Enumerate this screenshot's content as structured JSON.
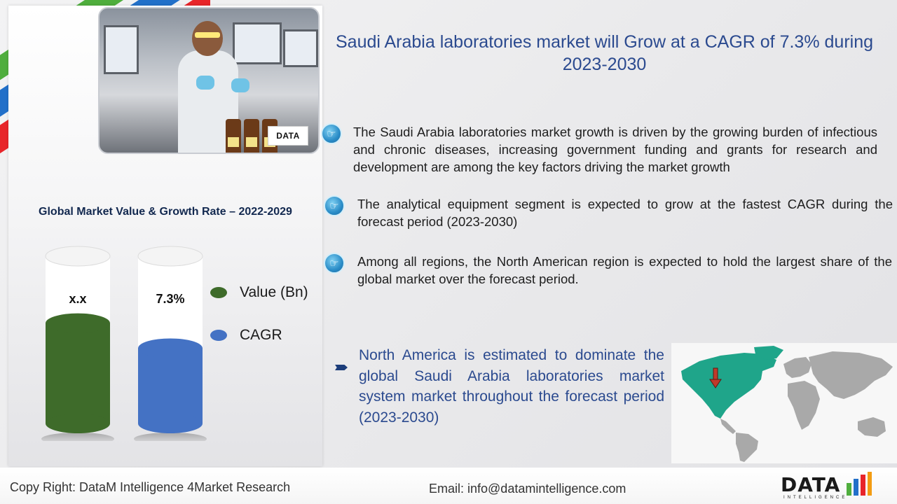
{
  "title": "Saudi Arabia laboratories market will Grow at a CAGR of 7.3% during 2023-2030",
  "photo": {
    "logo_text": "DATA"
  },
  "chart": {
    "title": "Global Market Value & Growth Rate – 2022-2029",
    "legend": [
      {
        "label": "Value (Bn)",
        "color": "#3e6b2a"
      },
      {
        "label": "CAGR",
        "color": "#4472c4"
      }
    ]
  },
  "chart_data": {
    "type": "bar",
    "title": "Global Market Value & Growth Rate – 2022-2029",
    "categories": [
      "Value (Bn)",
      "CAGR"
    ],
    "series": [
      {
        "name": "Value (Bn)",
        "label": "x.x",
        "fill_fraction": 0.6,
        "color": "#3e6b2a"
      },
      {
        "name": "CAGR",
        "label": "7.3%",
        "fill_fraction": 0.45,
        "color": "#4472c4"
      }
    ]
  },
  "bullets": [
    {
      "text": "The Saudi Arabia laboratories market growth is driven by the growing burden of infectious and chronic diseases, increasing government funding and grants for research and development are among the key factors driving the market growth"
    },
    {
      "text": "The analytical equipment segment is expected to grow at the fastest CAGR during the forecast period (2023-2030)"
    },
    {
      "text": "Among all regions, the North American region is expected to hold the largest share of the global market over the forecast period."
    }
  ],
  "highlight": "North America is estimated to dominate the global Saudi Arabia laboratories market system market throughout the forecast period (2023-2030)",
  "colors": {
    "accent": "#2b4a8f",
    "map_highlight": "#1fa58a",
    "map_base": "#a9a9a9"
  },
  "footer": {
    "copyright": "Copy Right: DataM Intelligence 4Market Research",
    "email": "Email: info@datamintelligence.com",
    "logo_word": "DATA",
    "logo_sub": "INTELLIGENCE"
  }
}
